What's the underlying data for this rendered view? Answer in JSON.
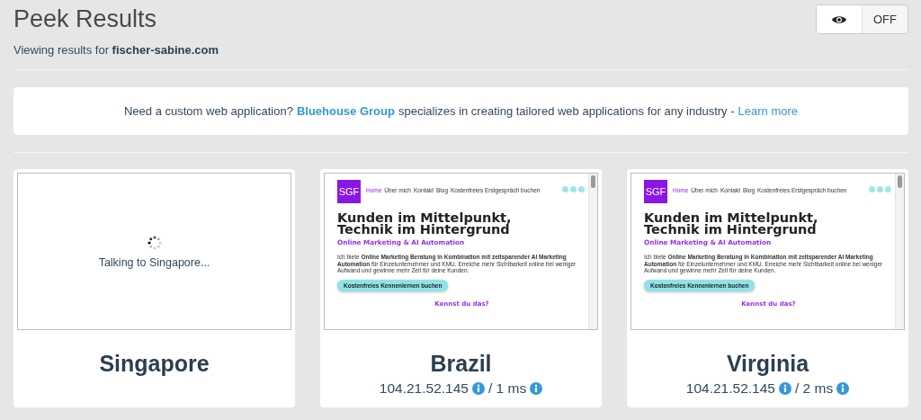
{
  "header": {
    "title": "Peek Results",
    "subtitle": "Viewing results for **fischer-sabine.com**"
  },
  "toggle": {
    "label": "OFF",
    "on": false
  },
  "banner": {
    "parts": [
      {
        "kind": "text",
        "text": "Need a custom web application?"
      },
      {
        "kind": "link",
        "text": "Bluehouse Group"
      },
      {
        "kind": "text",
        "text": "specializes in creating tailored web applications for any industry -"
      },
      {
        "kind": "link",
        "text": "Learn more"
      }
    ]
  },
  "results": [
    {
      "location": "Singapore",
      "kind": "loading",
      "message": "Talking to Singapore..."
    },
    {
      "location": "Brazil",
      "kind": "done",
      "ip": "104.21.52.145",
      "separator": "/",
      "latency": "1 ms",
      "preview": {
        "logo": "SGF",
        "nav": [
          {
            "label": "Home",
            "selected": true
          },
          {
            "label": "Über mich",
            "selected": false
          },
          {
            "label": "Kontakt",
            "selected": false
          },
          {
            "label": "Blog",
            "selected": false
          },
          {
            "label": "Kostenfreies Erstgespräch buchen",
            "selected": false
          }
        ],
        "headline": [
          "Kunden im Mittelpunkt,",
          "Technik im Hintergrund"
        ],
        "tagline": "Online Marketing & AI Automation",
        "paragraph": "Ich biete **Online Marketing Beratung in Kombination mit zeitsparender AI Marketing Automation** für Einzelunternehmer und KMU. Erreiche mehr Sichtbarkeit online bei weniger Aufwand und gewinne mehr Zeit für deine Kunden.",
        "button": "Kostenfreies Kennenlernen buchen",
        "next_heading": "Kennst du das?"
      }
    },
    {
      "location": "Virginia",
      "kind": "done",
      "ip": "104.21.52.145",
      "separator": "/",
      "latency": "2 ms",
      "preview": {
        "logo": "SGF",
        "nav": [
          {
            "label": "Home",
            "selected": true
          },
          {
            "label": "Über mich",
            "selected": false
          },
          {
            "label": "Kontakt",
            "selected": false
          },
          {
            "label": "Blog",
            "selected": false
          },
          {
            "label": "Kostenfreies Erstgespräch buchen",
            "selected": false
          }
        ],
        "headline": [
          "Kunden im Mittelpunkt,",
          "Technik im Hintergrund"
        ],
        "tagline": "Online Marketing & AI Automation",
        "paragraph": "Ich biete **Online Marketing Beratung in Kombination mit zeitsparender AI Marketing Automation** für Einzelunternehmer und KMU. Erreiche mehr Sichtbarkeit online bei weniger Aufwand und gewinne mehr Zeit für deine Kunden.",
        "button": "Kostenfreies Kennenlernen buchen",
        "next_heading": "Kennst du das?"
      }
    }
  ]
}
